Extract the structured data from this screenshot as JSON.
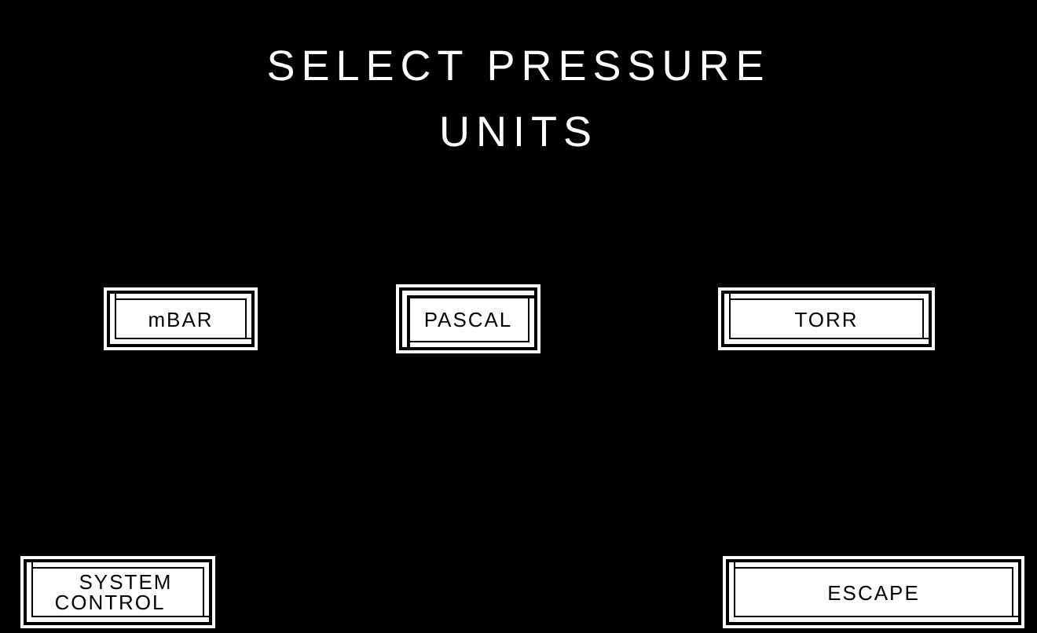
{
  "title": [
    "SELECT PRESSURE",
    "UNITS"
  ],
  "units": [
    {
      "label": "mBAR",
      "selected": false
    },
    {
      "label": "PASCAL",
      "selected": true
    },
    {
      "label": "TORR",
      "selected": false
    }
  ],
  "footer": {
    "left": [
      "SYSTEM",
      "CONTROL"
    ],
    "right": "ESCAPE"
  }
}
